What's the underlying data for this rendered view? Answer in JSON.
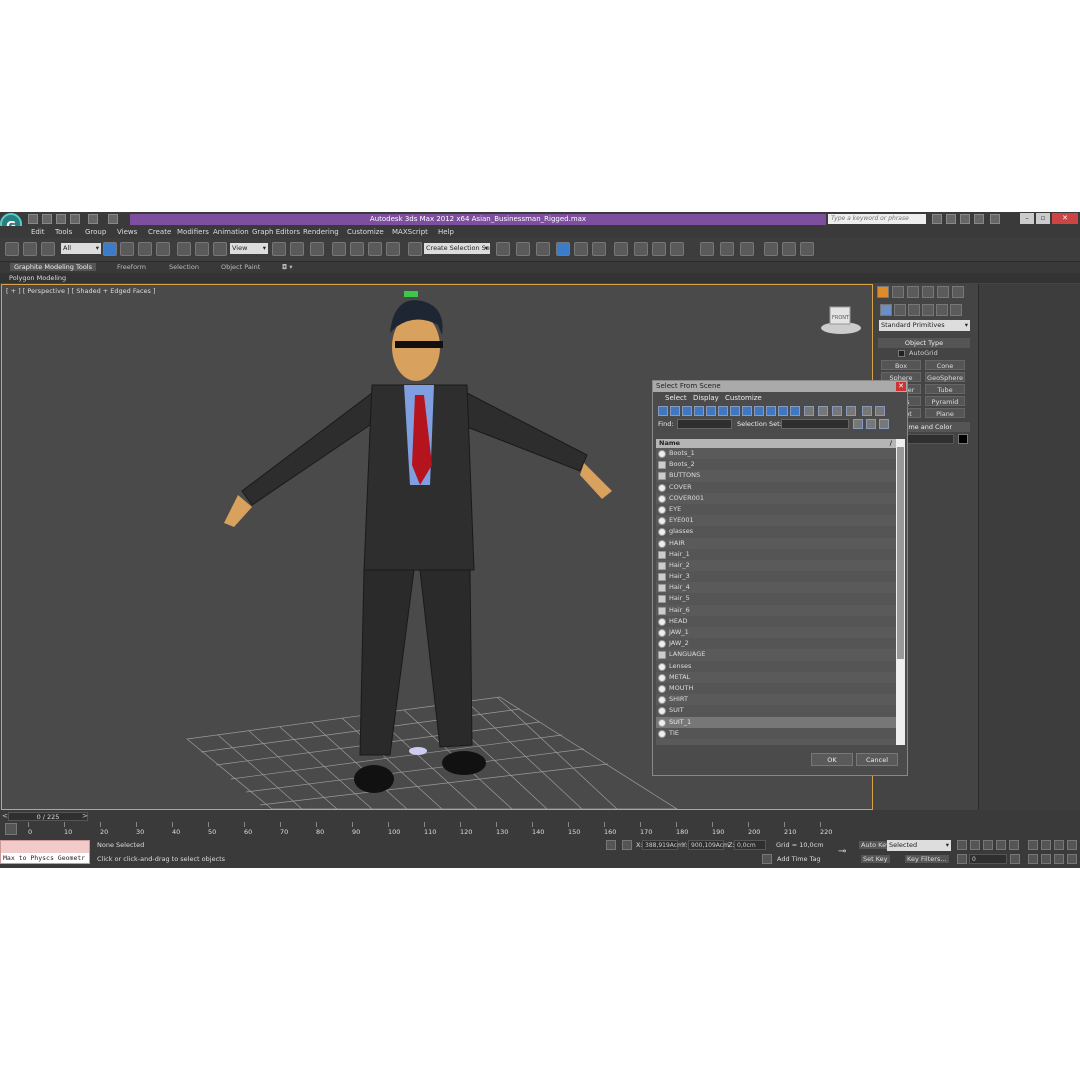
{
  "window": {
    "title": "Autodesk 3ds Max  2012 x64     Asian_Businessman_Rigged.max",
    "app_logo": "3ds-max-logo",
    "search_placeholder": "Type a keyword or phrase"
  },
  "menu": [
    "Edit",
    "Tools",
    "Group",
    "Views",
    "Create",
    "Modifiers",
    "Animation",
    "Graph Editors",
    "Rendering",
    "Customize",
    "MAXScript",
    "Help"
  ],
  "toolbar": {
    "filter_value": "All",
    "ref_coord_value": "View",
    "selection_set_placeholder": "Create Selection Se"
  },
  "ribbon": {
    "tabs": [
      "Graphite Modeling Tools",
      "Freeform",
      "Selection",
      "Object Paint"
    ],
    "subtab": "Polygon Modeling"
  },
  "viewport": {
    "label": "[ + ] [ Perspective ] [ Shaded + Edged Faces ]",
    "viewcube_label": "FRONT"
  },
  "command_panel": {
    "category_value": "Standard Primitives",
    "rollout_object_type": "Object Type",
    "autogrid_label": "AutoGrid",
    "buttons": [
      "Box",
      "Cone",
      "Sphere",
      "GeoSphere",
      "Cylinder",
      "Tube",
      "Torus",
      "Pyramid",
      "Teapot",
      "Plane"
    ],
    "rollout_name_color": "Name and Color"
  },
  "dialog": {
    "title": "Select From Scene",
    "menu": [
      "Select",
      "Display",
      "Customize"
    ],
    "find_label": "Find:",
    "selection_set_label": "Selection Set:",
    "column_header": "Name",
    "rows": [
      "Boots_1",
      "Boots_2",
      "BUTTONS",
      "COVER",
      "COVER001",
      "EYE",
      "EYE001",
      "glasses",
      "HAIR",
      "Hair_1",
      "Hair_2",
      "Hair_3",
      "Hair_4",
      "Hair_5",
      "Hair_6",
      "HEAD",
      "JAW_1",
      "JAW_2",
      "LANGUAGE",
      "Lenses",
      "METAL",
      "MOUTH",
      "SHIRT",
      "SUIT",
      "SUIT_1",
      "TIE"
    ],
    "selected_row": "SUIT_1",
    "ok_label": "OK",
    "cancel_label": "Cancel"
  },
  "timeline": {
    "frame_counter": "0 / 225",
    "ticks": [
      "0",
      "10",
      "20",
      "30",
      "40",
      "50",
      "60",
      "70",
      "80",
      "90",
      "100",
      "110",
      "120",
      "130",
      "140",
      "150",
      "160",
      "170",
      "180",
      "190",
      "200",
      "210",
      "220"
    ]
  },
  "status": {
    "maxscript_text": "Max to Physcs Geometr",
    "selection_status": "None Selected",
    "prompt": "Click or click-and-drag to select objects",
    "x_label": "X:",
    "x_value": "388,919Acm",
    "y_label": "Y:",
    "y_value": "900,109Acm",
    "z_label": "Z:",
    "z_value": "0,0cm",
    "grid": "Grid = 10,0cm",
    "add_time_tag": "Add Time Tag",
    "auto_key": "Auto Key",
    "set_key": "Set Key",
    "key_mode_value": "Selected",
    "key_filters": "Key Filters...",
    "current_frame": "0"
  }
}
